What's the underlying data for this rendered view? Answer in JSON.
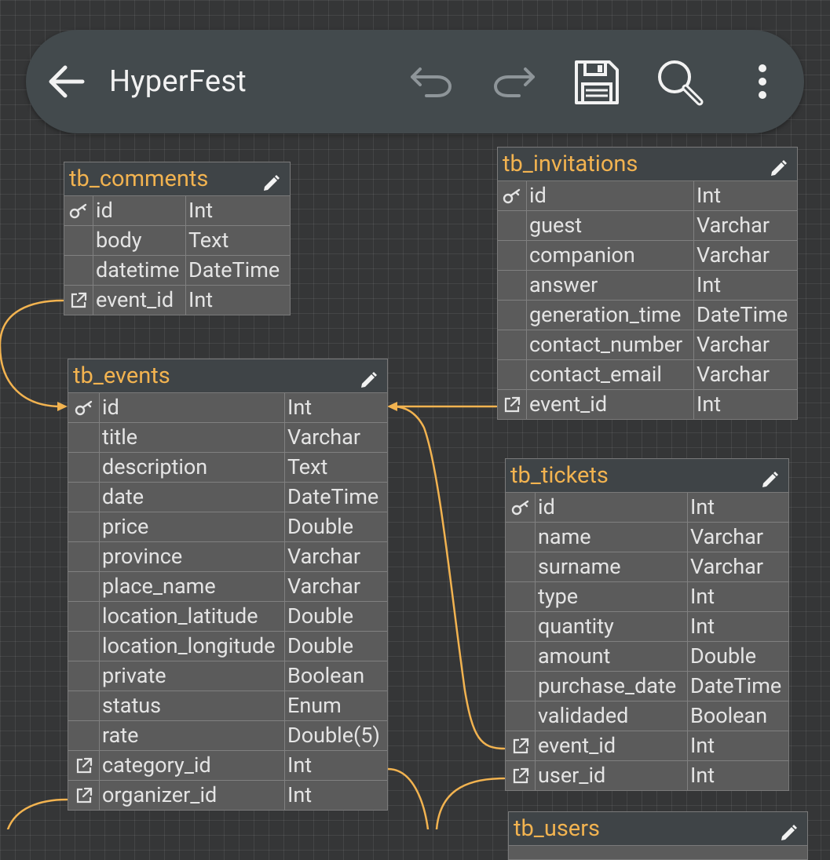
{
  "app": {
    "title": "HyperFest",
    "icons": [
      "back-arrow-icon",
      "undo-icon",
      "redo-icon",
      "save-icon",
      "search-icon",
      "more-vert-icon"
    ]
  },
  "colors": {
    "background": "#353637",
    "toolbar": "#434a4d",
    "table_header": "#3f4447",
    "table_body": "#5b5b5b",
    "table_title": "#f2b350",
    "relation_line": "#f2b350",
    "text": "#e4e4e4"
  },
  "tables": {
    "comments": {
      "name": "tb_comments",
      "rows": [
        {
          "icon": "key-icon",
          "name": "id",
          "type": "Int"
        },
        {
          "icon": "",
          "name": "body",
          "type": "Text"
        },
        {
          "icon": "",
          "name": "datetime",
          "type": "DateTime"
        },
        {
          "icon": "foreign-key-icon",
          "name": "event_id",
          "type": "Int"
        }
      ]
    },
    "invitations": {
      "name": "tb_invitations",
      "rows": [
        {
          "icon": "key-icon",
          "name": "id",
          "type": "Int"
        },
        {
          "icon": "",
          "name": "guest",
          "type": "Varchar"
        },
        {
          "icon": "",
          "name": "companion",
          "type": "Varchar"
        },
        {
          "icon": "",
          "name": "answer",
          "type": "Int"
        },
        {
          "icon": "",
          "name": "generation_time",
          "type": "DateTime"
        },
        {
          "icon": "",
          "name": "contact_number",
          "type": "Varchar"
        },
        {
          "icon": "",
          "name": "contact_email",
          "type": "Varchar"
        },
        {
          "icon": "foreign-key-icon",
          "name": "event_id",
          "type": "Int"
        }
      ]
    },
    "events": {
      "name": "tb_events",
      "rows": [
        {
          "icon": "key-icon",
          "name": "id",
          "type": "Int"
        },
        {
          "icon": "",
          "name": "title",
          "type": "Varchar"
        },
        {
          "icon": "",
          "name": "description",
          "type": "Text"
        },
        {
          "icon": "",
          "name": "date",
          "type": "DateTime"
        },
        {
          "icon": "",
          "name": "price",
          "type": "Double"
        },
        {
          "icon": "",
          "name": "province",
          "type": "Varchar"
        },
        {
          "icon": "",
          "name": "place_name",
          "type": "Varchar"
        },
        {
          "icon": "",
          "name": "location_latitude",
          "type": "Double"
        },
        {
          "icon": "",
          "name": "location_longitude",
          "type": "Double"
        },
        {
          "icon": "",
          "name": "private",
          "type": "Boolean"
        },
        {
          "icon": "",
          "name": "status",
          "type": "Enum"
        },
        {
          "icon": "",
          "name": "rate",
          "type": "Double(5)"
        },
        {
          "icon": "foreign-key-icon",
          "name": "category_id",
          "type": "Int"
        },
        {
          "icon": "foreign-key-icon",
          "name": "organizer_id",
          "type": "Int"
        }
      ]
    },
    "tickets": {
      "name": "tb_tickets",
      "rows": [
        {
          "icon": "key-icon",
          "name": "id",
          "type": "Int"
        },
        {
          "icon": "",
          "name": "name",
          "type": "Varchar"
        },
        {
          "icon": "",
          "name": "surname",
          "type": "Varchar"
        },
        {
          "icon": "",
          "name": "type",
          "type": "Int"
        },
        {
          "icon": "",
          "name": "quantity",
          "type": "Int"
        },
        {
          "icon": "",
          "name": "amount",
          "type": "Double"
        },
        {
          "icon": "",
          "name": "purchase_date",
          "type": "DateTime"
        },
        {
          "icon": "",
          "name": "validaded",
          "type": "Boolean"
        },
        {
          "icon": "foreign-key-icon",
          "name": "event_id",
          "type": "Int"
        },
        {
          "icon": "foreign-key-icon",
          "name": "user_id",
          "type": "Int"
        }
      ]
    },
    "users": {
      "name": "tb_users",
      "rows": []
    }
  }
}
